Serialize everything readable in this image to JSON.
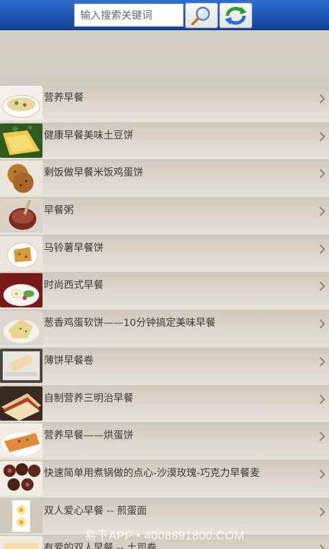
{
  "search": {
    "placeholder": "输入搜索关键词"
  },
  "toolbar": {
    "search_icon": "magnifier-icon",
    "refresh_icon": "refresh-icon"
  },
  "items": [
    {
      "title": "营养早餐",
      "thumb": "bowl"
    },
    {
      "title": "健康早餐美味土豆饼",
      "thumb": "omelette"
    },
    {
      "title": "剩饭做早餐米饭鸡蛋饼",
      "thumb": "patty"
    },
    {
      "title": "早餐粥",
      "thumb": "porridge"
    },
    {
      "title": "马铃薯早餐饼",
      "thumb": "plate"
    },
    {
      "title": "时尚西式早餐",
      "thumb": "western"
    },
    {
      "title": "葱香鸡蛋软饼——10分钟搞定美味早餐",
      "thumb": "softcake"
    },
    {
      "title": "薄饼早餐卷",
      "thumb": "roll"
    },
    {
      "title": "自制营养三明治早餐",
      "thumb": "sandwich"
    },
    {
      "title": "营养早餐——烘蛋饼",
      "thumb": "pancake"
    },
    {
      "title": "快速简单用煮锅做的点心-沙漠玫瑰-巧克力早餐麦",
      "thumb": "chocolate"
    },
    {
      "title": "双人爱心早餐 -- 煎蛋面",
      "thumb": "noodle"
    },
    {
      "title": "有爱的双人早餐 -- 土司卷",
      "thumb": "toast"
    }
  ],
  "watermark": "易下APP • 4008891800.COM"
}
